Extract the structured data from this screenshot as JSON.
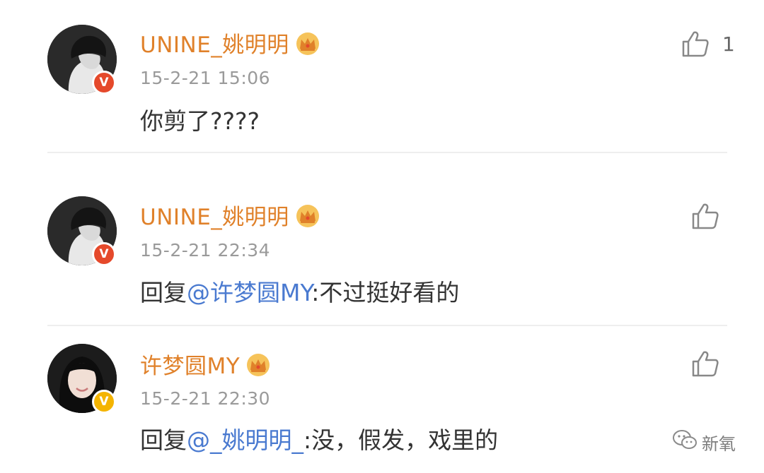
{
  "comments": [
    {
      "user": "UNINE_姚明明",
      "verified_badge": "V",
      "time": "15-2-21 15:06",
      "text": "你剪了????",
      "likes": "1"
    },
    {
      "user": "UNINE_姚明明",
      "verified_badge": "V",
      "time": "15-2-21 22:34",
      "reply_prefix": "回复",
      "mention": "@许梦圆MY",
      "reply_text": ":不过挺好看的"
    },
    {
      "user": "许梦圆MY",
      "verified_badge": "V",
      "time": "15-2-21 22:30",
      "reply_prefix": "回复",
      "mention": "@_姚明明_",
      "reply_text": ":没，假发，戏里的"
    }
  ],
  "watermark": {
    "text": "新氧"
  },
  "colors": {
    "username": "#e0812a",
    "mention": "#4a7ad0",
    "badge_red": "#e5492b",
    "badge_gold": "#f4b400",
    "timestamp": "#9a9a9a"
  }
}
